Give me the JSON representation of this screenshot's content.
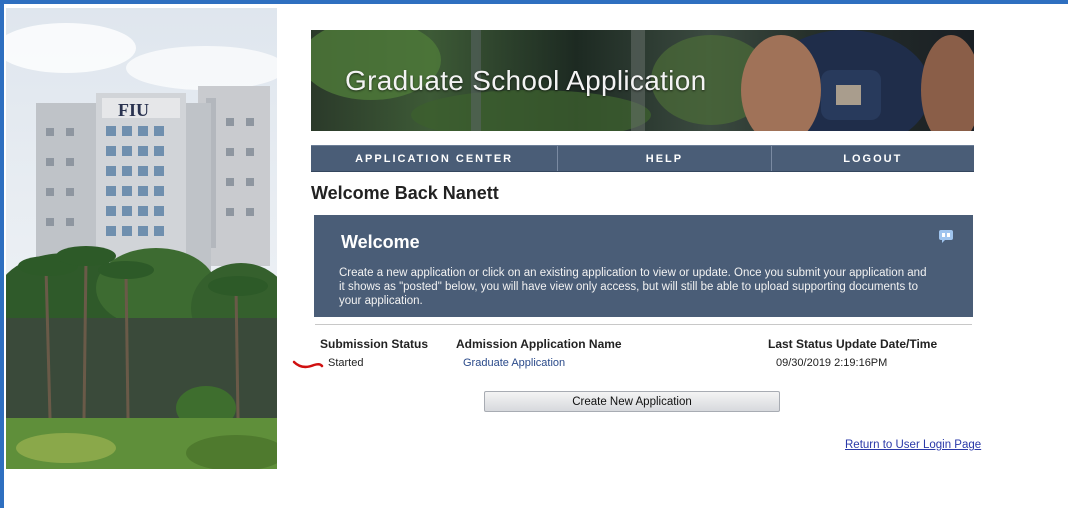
{
  "banner": {
    "title": "Graduate School Application"
  },
  "campus_photo": {
    "building_sign": "FIU"
  },
  "nav": {
    "items": [
      {
        "label": "APPLICATION CENTER"
      },
      {
        "label": "HELP"
      },
      {
        "label": "LOGOUT"
      }
    ]
  },
  "greeting": "Welcome Back Nanett",
  "panel": {
    "title": "Welcome",
    "text": "Create a new application or click on an existing application to view or update. Once you submit your application and it shows as \"posted\" below, you will have view only access, but will still be able to upload supporting documents to your application.",
    "icon": "comment-icon"
  },
  "table": {
    "headers": {
      "status": "Submission Status",
      "name": "Admission Application Name",
      "date": "Last Status Update Date/Time"
    },
    "rows": [
      {
        "status": "Started",
        "name": "Graduate Application",
        "date": "09/30/2019  2:19:16PM"
      }
    ]
  },
  "buttons": {
    "create": "Create New Application"
  },
  "links": {
    "return_login": "Return to User Login Page"
  },
  "colors": {
    "nav": "#4a5d77",
    "panel": "#4a5d77",
    "accent_rule": "#2e6fc0",
    "link": "#2a39a8",
    "marker": "#d01010"
  }
}
